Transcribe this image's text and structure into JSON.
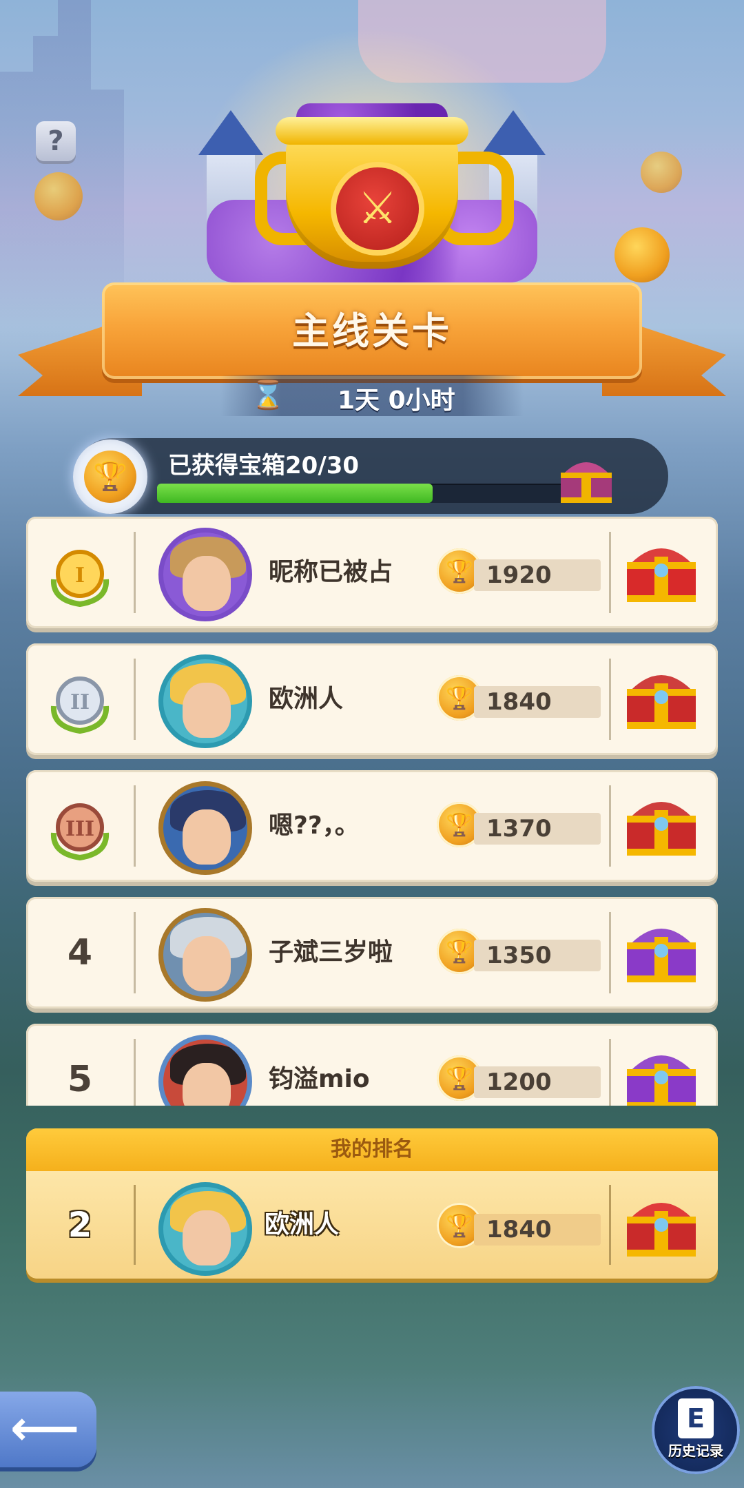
{
  "event": {
    "title": "主线关卡",
    "timer": "1天 0小时",
    "progress_label": "已获得宝箱20/30",
    "progress_value": 0.667
  },
  "icons": {
    "help": "?",
    "hourglass": "⌛",
    "back": "⟵",
    "history": "📖",
    "trophy": "🏆",
    "swords": "⚔"
  },
  "leaderboard": [
    {
      "rank": "1",
      "name": "昵称已被占",
      "score": "1920",
      "rank_badge": "gold",
      "chest": "gold-red"
    },
    {
      "rank": "2",
      "name": "欧洲人",
      "score": "1840",
      "rank_badge": "silver",
      "chest": "red"
    },
    {
      "rank": "3",
      "name": "嗯??，。",
      "score": "1370",
      "rank_badge": "bronze",
      "chest": "red"
    },
    {
      "rank": "4",
      "name": "子斌三岁啦",
      "score": "1350",
      "rank_badge": "",
      "chest": "purple"
    },
    {
      "rank": "5",
      "name": "钧溢mio",
      "score": "1200",
      "rank_badge": "",
      "chest": "purple"
    }
  ],
  "my_rank": {
    "header": "我的排名",
    "rank": "2",
    "name": "欧洲人",
    "score": "1840"
  },
  "history_label": "历史记录",
  "colors": {
    "ribbon": "#f8a43a",
    "progress_fill": "#3fb822",
    "row_bg": "#fdf6e8",
    "my_panel": "#f5b01c"
  }
}
